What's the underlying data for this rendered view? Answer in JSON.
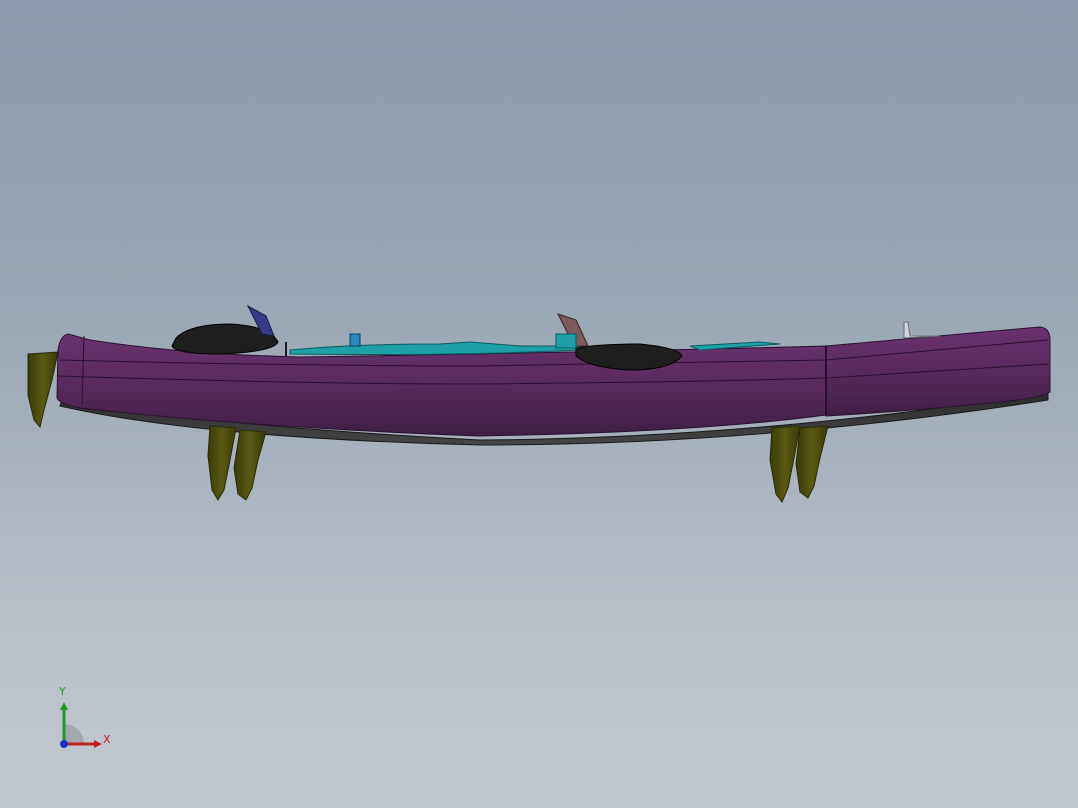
{
  "viewport": {
    "background_top": "#8a9aac",
    "background_bottom": "#c3c9d0"
  },
  "model": {
    "hull_color": "#5c2a60",
    "hull_dark": "#3a1c3e",
    "fin_color": "#4a4a10",
    "seat_color": "#1e1e1e",
    "deck_accent": "#1fa0a8"
  },
  "triad": {
    "x_label": "X",
    "y_label": "Y",
    "x_color": "#c02020",
    "y_color": "#1a9a2a",
    "z_color": "#2030c0"
  }
}
